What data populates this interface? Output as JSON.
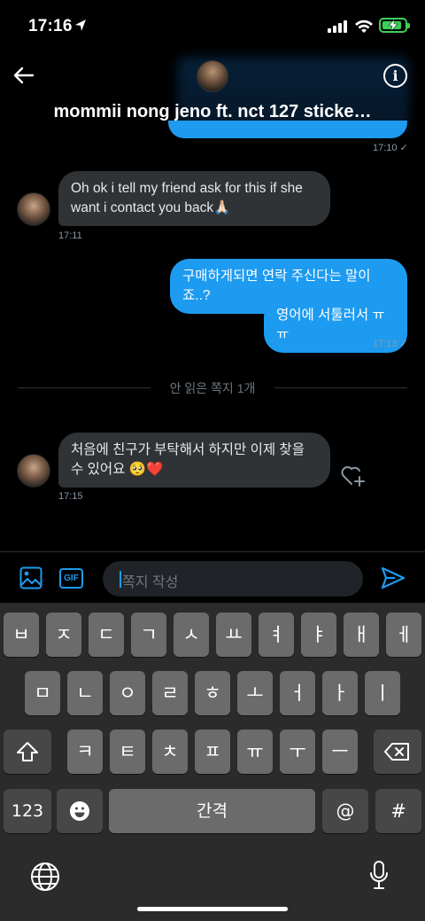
{
  "status": {
    "time": "17:16"
  },
  "header": {
    "title": "mommii nong jeno ft. nct 127 sticke…"
  },
  "messages": {
    "prev_time": "17:10 ✓",
    "m1": {
      "text": "Oh ok i tell my friend ask for this if she want i contact you back🙏🏻",
      "time": "17:11"
    },
    "m2": {
      "text": "구매하게되면 연락 주신다는 말이죠..?"
    },
    "m3": {
      "text": "영어에 서툴러서 ㅠㅠ",
      "time": "17:13 ✓"
    },
    "m4": {
      "text": "처음에 친구가 부탁해서 하지만 이제 찾을 수 있어요 🥺❤️",
      "time": "17:15"
    }
  },
  "divider": {
    "text": "안 읽은 쪽지 1개"
  },
  "composer": {
    "placeholder": "쪽지 작성",
    "gif_label": "GIF"
  },
  "keyboard": {
    "row1": [
      "ㅂ",
      "ㅈ",
      "ㄷ",
      "ㄱ",
      "ㅅ",
      "ㅛ",
      "ㅕ",
      "ㅑ",
      "ㅐ",
      "ㅔ"
    ],
    "row2": [
      "ㅁ",
      "ㄴ",
      "ㅇ",
      "ㄹ",
      "ㅎ",
      "ㅗ",
      "ㅓ",
      "ㅏ",
      "ㅣ"
    ],
    "row3": [
      "ㅋ",
      "ㅌ",
      "ㅊ",
      "ㅍ",
      "ㅠ",
      "ㅜ",
      "ㅡ"
    ],
    "num_label": "123",
    "space_label": "간격",
    "at_label": "@",
    "hash_label": "#"
  },
  "colors": {
    "accent": "#1d9bf0",
    "bubble_in": "#2f3336"
  }
}
